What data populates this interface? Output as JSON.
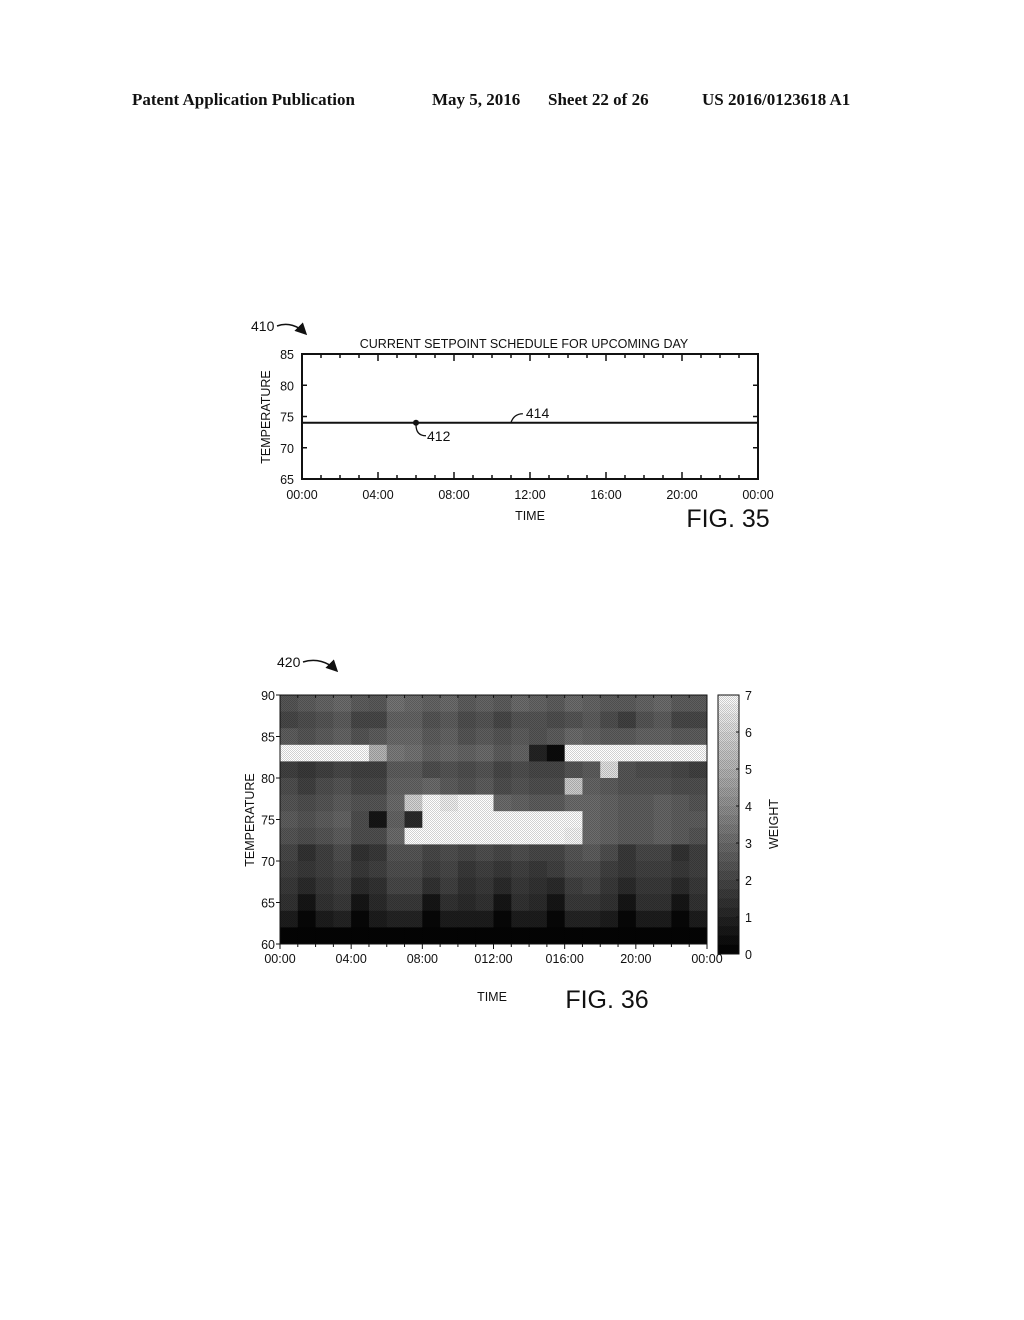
{
  "header": {
    "publication": "Patent Application Publication",
    "date": "May 5, 2016",
    "sheet": "Sheet 22 of 26",
    "number": "US 2016/0123618 A1"
  },
  "chart_data": [
    {
      "type": "line",
      "figure_label": "FIG. 35",
      "reference": "410",
      "title": "CURRENT SETPOINT SCHEDULE FOR UPCOMING DAY",
      "xlabel": "TIME",
      "ylabel": "TEMPERATURE",
      "xticks": [
        "00:00",
        "04:00",
        "08:00",
        "12:00",
        "16:00",
        "20:00",
        "00:00"
      ],
      "xlim_hours": [
        0,
        24
      ],
      "yticks": [
        65,
        70,
        75,
        80,
        85
      ],
      "ylim": [
        65,
        85
      ],
      "grid": false,
      "series": [
        {
          "name": "setpoint",
          "reference": "414",
          "x_hours": [
            0,
            24
          ],
          "values": [
            74,
            74
          ]
        }
      ],
      "points": [
        {
          "reference": "412",
          "x_hours": 6,
          "value": 74
        }
      ],
      "annotations": [
        {
          "text": "412",
          "target": "setpoint point at 06:00"
        },
        {
          "text": "414",
          "target": "setpoint line near 11:00"
        }
      ]
    },
    {
      "type": "heatmap",
      "figure_label": "FIG. 36",
      "reference": "420",
      "title": "",
      "xlabel": "TIME",
      "ylabel": "TEMPERATURE",
      "colorbar_label": "WEIGHT",
      "xticks": [
        "00:00",
        "04:00",
        "08:00",
        "012:00",
        "016:00",
        "20:00",
        "00:00"
      ],
      "xlim_hours": [
        0,
        24
      ],
      "yticks": [
        60,
        65,
        70,
        75,
        80,
        85,
        90
      ],
      "ylim": [
        60,
        90
      ],
      "colorbar_ticks": [
        0,
        1,
        2,
        3,
        4,
        5,
        6,
        7
      ],
      "colorbar_range": [
        0,
        7
      ],
      "colormap": "grayscale",
      "grid_note": "rows = 2°F bins from 90 (top) down to 60; columns = 1-hour bins 00:00-24:00",
      "row_temps": [
        89,
        87,
        85,
        83,
        81,
        79,
        77,
        75,
        73,
        71,
        69,
        67,
        65,
        63,
        61
      ],
      "weights": [
        [
          2.4,
          2.6,
          2.8,
          3.0,
          2.6,
          2.5,
          3.2,
          3.0,
          2.8,
          3.0,
          2.6,
          2.8,
          2.6,
          3.0,
          2.8,
          2.6,
          3.0,
          2.8,
          2.6,
          2.6,
          2.8,
          3.0,
          2.6,
          2.6
        ],
        [
          2.0,
          2.2,
          2.4,
          2.6,
          2.0,
          2.0,
          2.8,
          2.8,
          2.4,
          2.6,
          2.2,
          2.4,
          2.0,
          2.4,
          2.4,
          2.2,
          2.4,
          2.6,
          2.2,
          1.8,
          2.4,
          2.6,
          2.0,
          2.0
        ],
        [
          2.6,
          2.4,
          2.6,
          2.8,
          2.4,
          2.6,
          3.0,
          3.0,
          2.6,
          2.8,
          2.4,
          2.6,
          2.4,
          2.6,
          2.4,
          2.6,
          3.0,
          2.8,
          2.6,
          2.6,
          2.8,
          2.8,
          2.6,
          2.6
        ],
        [
          7.0,
          7.0,
          7.0,
          7.0,
          7.0,
          5.0,
          3.4,
          3.2,
          2.8,
          3.0,
          2.8,
          3.0,
          2.6,
          2.8,
          1.0,
          0.3,
          7.0,
          7.0,
          7.0,
          7.0,
          7.0,
          7.0,
          7.0,
          7.0
        ],
        [
          1.8,
          1.6,
          1.8,
          2.0,
          1.8,
          1.8,
          2.6,
          2.6,
          2.2,
          2.4,
          2.2,
          2.4,
          2.0,
          2.2,
          2.0,
          2.0,
          2.4,
          2.6,
          6.2,
          2.4,
          2.2,
          2.2,
          2.0,
          1.8
        ],
        [
          2.2,
          1.8,
          2.2,
          2.4,
          2.0,
          2.0,
          2.8,
          2.8,
          3.0,
          2.6,
          2.4,
          2.6,
          2.2,
          2.4,
          2.2,
          2.2,
          5.6,
          2.8,
          2.6,
          2.4,
          2.4,
          2.4,
          2.2,
          2.2
        ],
        [
          2.4,
          2.2,
          2.4,
          2.6,
          2.4,
          2.4,
          3.0,
          5.8,
          7.0,
          6.6,
          7.0,
          7.0,
          3.0,
          2.8,
          2.6,
          2.6,
          3.0,
          3.0,
          2.8,
          2.6,
          2.6,
          2.8,
          2.6,
          2.4
        ],
        [
          2.6,
          2.4,
          2.6,
          2.8,
          2.2,
          0.6,
          2.8,
          1.2,
          7.0,
          7.0,
          7.0,
          7.0,
          7.0,
          7.0,
          7.0,
          7.0,
          7.0,
          3.0,
          2.8,
          2.6,
          2.6,
          2.8,
          2.6,
          2.6
        ],
        [
          2.4,
          2.2,
          2.4,
          2.6,
          2.2,
          2.2,
          3.0,
          7.0,
          7.0,
          7.0,
          7.0,
          7.0,
          7.0,
          7.0,
          7.0,
          7.0,
          6.8,
          3.0,
          2.8,
          2.6,
          2.6,
          2.8,
          2.6,
          2.4
        ],
        [
          2.0,
          1.4,
          1.8,
          2.2,
          1.4,
          1.6,
          2.4,
          2.4,
          2.0,
          2.2,
          2.0,
          2.2,
          2.0,
          2.2,
          2.0,
          2.0,
          2.4,
          2.6,
          2.2,
          1.6,
          2.0,
          2.0,
          1.4,
          1.8
        ],
        [
          1.8,
          1.6,
          1.8,
          2.0,
          1.6,
          1.8,
          2.2,
          2.2,
          1.8,
          2.0,
          1.6,
          1.8,
          1.6,
          1.8,
          1.6,
          1.8,
          2.2,
          2.2,
          1.8,
          1.6,
          1.8,
          1.8,
          1.6,
          1.8
        ],
        [
          1.6,
          1.2,
          1.6,
          1.8,
          1.2,
          1.4,
          2.0,
          2.0,
          1.4,
          1.8,
          1.4,
          1.6,
          1.2,
          1.6,
          1.4,
          1.2,
          1.8,
          2.0,
          1.6,
          1.2,
          1.6,
          1.6,
          1.2,
          1.6
        ],
        [
          1.4,
          0.6,
          1.4,
          1.6,
          0.6,
          1.2,
          1.6,
          1.6,
          0.6,
          1.4,
          1.2,
          1.4,
          0.6,
          1.4,
          1.2,
          0.6,
          1.6,
          1.6,
          1.4,
          0.6,
          1.4,
          1.4,
          0.6,
          1.4
        ],
        [
          0.8,
          0.2,
          0.8,
          1.0,
          0.2,
          0.8,
          1.0,
          1.0,
          0.2,
          0.8,
          0.8,
          0.8,
          0.2,
          0.8,
          0.8,
          0.2,
          1.0,
          1.0,
          0.8,
          0.2,
          0.8,
          0.8,
          0.2,
          0.8
        ],
        [
          0.1,
          0.1,
          0.1,
          0.1,
          0.1,
          0.1,
          0.1,
          0.1,
          0.1,
          0.1,
          0.1,
          0.1,
          0.1,
          0.1,
          0.1,
          0.1,
          0.1,
          0.1,
          0.1,
          0.1,
          0.1,
          0.1,
          0.1,
          0.1
        ]
      ]
    }
  ]
}
